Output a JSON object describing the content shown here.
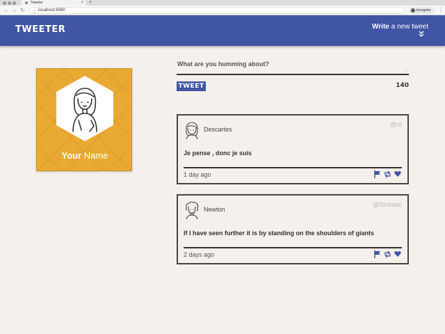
{
  "browser": {
    "tab_title": "Tweeter",
    "tab_close": "×",
    "new_tab": "+",
    "url": "localhost:8080",
    "incognito_label": "Incognito",
    "back_icon": "arrow-left-icon",
    "forward_icon": "arrow-right-icon",
    "reload_icon": "reload-icon"
  },
  "header": {
    "brand": "TWEETER",
    "compose_bold": "Write",
    "compose_rest": " a new tweet",
    "compose_icon": "double-chevron-down-icon",
    "bg_color": "#4055a3"
  },
  "profile": {
    "name_first": "Your",
    "name_last": " Name",
    "card_color": "#e8aa32"
  },
  "composer": {
    "prompt": "What are you humming about?",
    "button_label": "TWEET",
    "char_count": "140"
  },
  "tweets": [
    {
      "author": "Descartes",
      "handle": "@rd",
      "text": "Je pense , donc je suis",
      "time": "1 day ago",
      "avatar_icon": "girl-avatar-icon"
    },
    {
      "author": "Newton",
      "handle": "@SirIsaac",
      "text": "If I have seen further it is by standing on the shoulders of giants",
      "time": "2 days ago",
      "avatar_icon": "curly-hair-avatar-icon"
    }
  ],
  "actions": {
    "icons": [
      "flag-icon",
      "retweet-icon",
      "heart-icon"
    ],
    "color": "#4055a3"
  }
}
